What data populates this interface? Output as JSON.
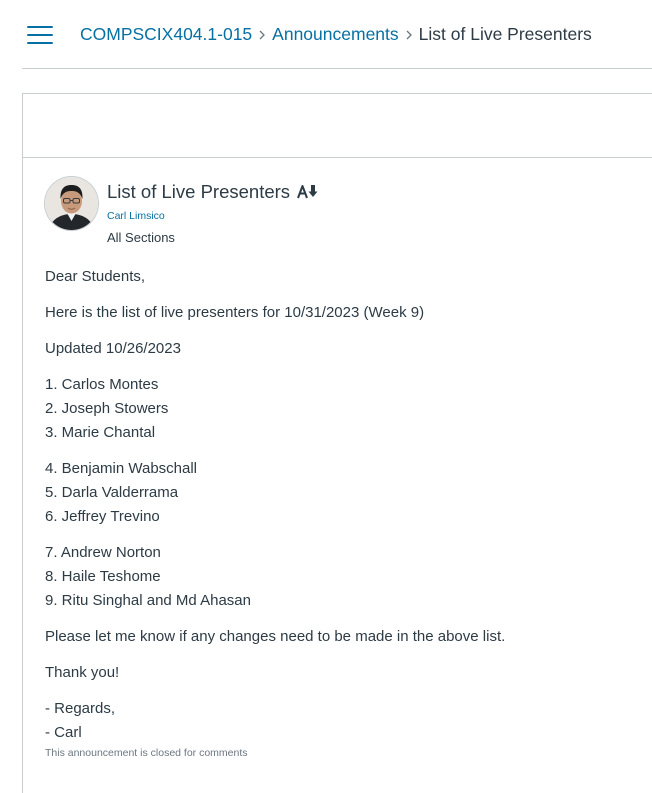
{
  "breadcrumb": {
    "course": "COMPSCIX404.1-015",
    "section": "Announcements",
    "current": "List of Live Presenters"
  },
  "announcement": {
    "title": "List of Live Presenters",
    "author": "Carl Limsico",
    "sections": "All Sections",
    "body": {
      "greeting": "Dear Students,",
      "intro": "Here is the list of live presenters for 10/31/2023 (Week 9)",
      "updated": "Updated 10/26/2023",
      "presenters": [
        "1. Carlos Montes",
        "2. Joseph Stowers",
        "3. Marie Chantal",
        "4. Benjamin Wabschall",
        "5. Darla Valderrama",
        "6. Jeffrey Trevino",
        "7. Andrew Norton",
        "8. Haile Teshome",
        "9. Ritu Singhal and Md Ahasan"
      ],
      "request": "Please let me know if any changes need to be made in the above list.",
      "thanks": "Thank you!",
      "regards": "- Regards,",
      "signature": "- Carl"
    },
    "closed_note": "This announcement is closed for comments"
  },
  "icons": {
    "menu": "hamburger-icon",
    "separator": "chevron-right-icon",
    "sort": "sort-icon"
  },
  "colors": {
    "link": "#0770a3",
    "text": "#2d3b45",
    "border": "#c7cdd1"
  }
}
